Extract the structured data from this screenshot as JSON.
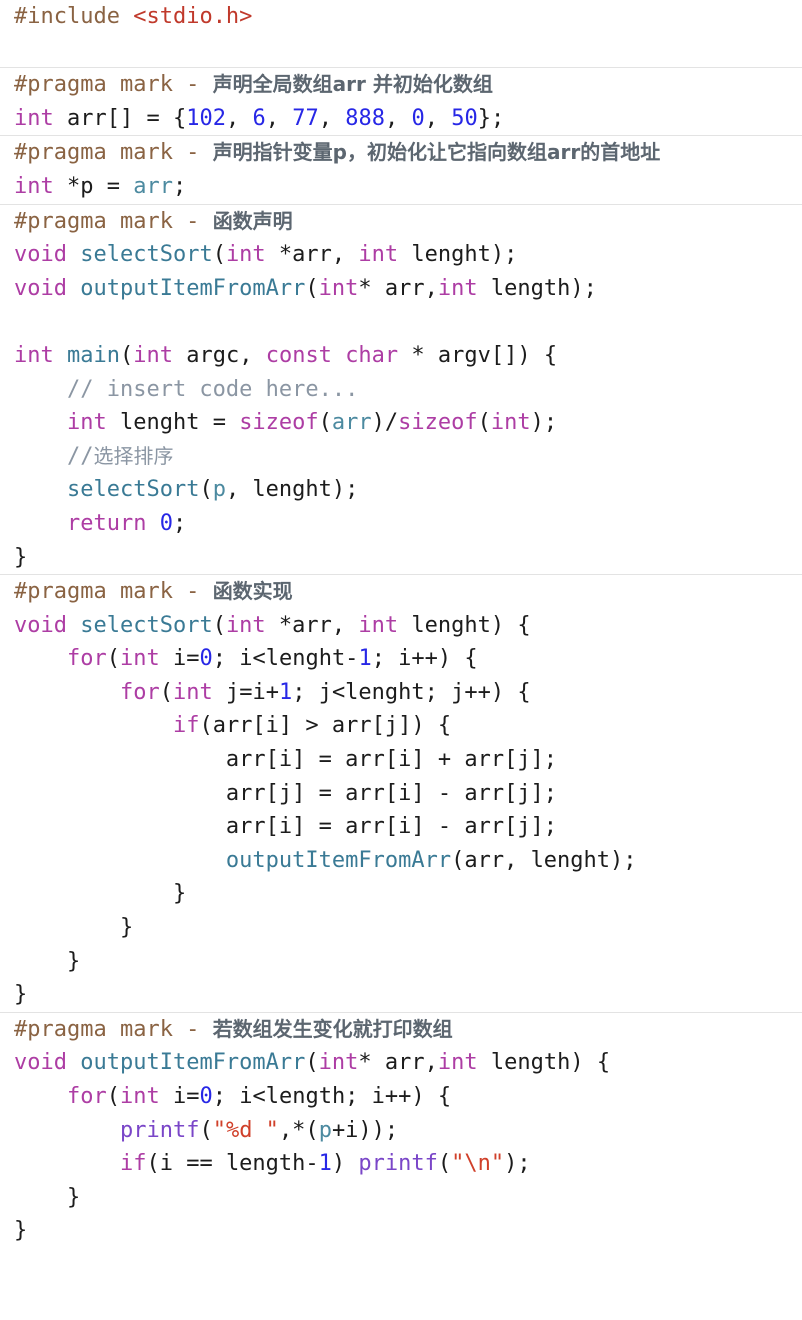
{
  "document": {
    "title": "C source code — selection sort with pointers",
    "language": "c",
    "background": "#ffffff",
    "separator_color": "#e3e3e3"
  },
  "theme": {
    "preprocessor": "#8a6343",
    "header_path": "#c0392b",
    "pragma_text": "#5c6670",
    "keyword": "#ad3da4",
    "number": "#2727e6",
    "function": "#3a7a95",
    "variable": "#4c8aa0",
    "comment": "#8b96a3",
    "builtin": "#7a46c8",
    "string": "#d0402a",
    "plain": "#1c1c1c"
  },
  "sections": [
    {
      "name": "include-section",
      "lines": [
        {
          "id": "l1",
          "text": "#include <stdio.h>",
          "tokens": [
            {
              "t": "#include ",
              "c": "tok-pre"
            },
            {
              "t": "<stdio.h>",
              "c": "tok-header"
            }
          ]
        },
        {
          "id": "l2",
          "text": "",
          "tokens": []
        }
      ]
    },
    {
      "name": "global-array-section",
      "lines": [
        {
          "id": "l3",
          "text": "#pragma mark - 声明全局数组arr 并初始化数组",
          "tokens": [
            {
              "t": "#pragma mark - ",
              "c": "tok-pre"
            },
            {
              "t": "声明全局数组arr 并初始化数组",
              "c": "tok-pragma-cn"
            }
          ]
        },
        {
          "id": "l4",
          "text": "int arr[] = {102, 6, 77, 888, 0, 50};",
          "tokens": [
            {
              "t": "int",
              "c": "tok-kw"
            },
            {
              "t": " arr[] = {",
              "c": "tok-plain"
            },
            {
              "t": "102",
              "c": "tok-num"
            },
            {
              "t": ", ",
              "c": "tok-plain"
            },
            {
              "t": "6",
              "c": "tok-num"
            },
            {
              "t": ", ",
              "c": "tok-plain"
            },
            {
              "t": "77",
              "c": "tok-num"
            },
            {
              "t": ", ",
              "c": "tok-plain"
            },
            {
              "t": "888",
              "c": "tok-num"
            },
            {
              "t": ", ",
              "c": "tok-plain"
            },
            {
              "t": "0",
              "c": "tok-num"
            },
            {
              "t": ", ",
              "c": "tok-plain"
            },
            {
              "t": "50",
              "c": "tok-num"
            },
            {
              "t": "};",
              "c": "tok-plain"
            }
          ]
        }
      ]
    },
    {
      "name": "pointer-declaration-section",
      "lines": [
        {
          "id": "l5",
          "text": "#pragma mark - 声明指针变量p, 初始化让它指向数组arr的首地址",
          "tokens": [
            {
              "t": "#pragma mark - ",
              "c": "tok-pre"
            },
            {
              "t": "声明指针变量p，初始化让它指向数组arr的首地址",
              "c": "tok-pragma-cn"
            }
          ]
        },
        {
          "id": "l6",
          "text": "int *p = arr;",
          "tokens": [
            {
              "t": "int",
              "c": "tok-kw"
            },
            {
              "t": " *p = ",
              "c": "tok-plain"
            },
            {
              "t": "arr",
              "c": "tok-var"
            },
            {
              "t": ";",
              "c": "tok-plain"
            }
          ]
        }
      ]
    },
    {
      "name": "function-declaration-section",
      "lines": [
        {
          "id": "l7",
          "text": "#pragma mark - 函数声明",
          "tokens": [
            {
              "t": "#pragma mark - ",
              "c": "tok-pre"
            },
            {
              "t": "函数声明",
              "c": "tok-pragma-cn"
            }
          ]
        },
        {
          "id": "l8",
          "text": "void selectSort(int *arr, int lenght);",
          "tokens": [
            {
              "t": "void",
              "c": "tok-kw"
            },
            {
              "t": " ",
              "c": "tok-plain"
            },
            {
              "t": "selectSort",
              "c": "tok-fn"
            },
            {
              "t": "(",
              "c": "tok-plain"
            },
            {
              "t": "int",
              "c": "tok-kw"
            },
            {
              "t": " *arr, ",
              "c": "tok-plain"
            },
            {
              "t": "int",
              "c": "tok-kw"
            },
            {
              "t": " lenght);",
              "c": "tok-plain"
            }
          ]
        },
        {
          "id": "l9",
          "text": "void outputItemFromArr(int* arr,int length);",
          "tokens": [
            {
              "t": "void",
              "c": "tok-kw"
            },
            {
              "t": " ",
              "c": "tok-plain"
            },
            {
              "t": "outputItemFromArr",
              "c": "tok-fn"
            },
            {
              "t": "(",
              "c": "tok-plain"
            },
            {
              "t": "int",
              "c": "tok-kw"
            },
            {
              "t": "* arr,",
              "c": "tok-plain"
            },
            {
              "t": "int",
              "c": "tok-kw"
            },
            {
              "t": " length);",
              "c": "tok-plain"
            }
          ]
        },
        {
          "id": "l10",
          "text": "",
          "tokens": []
        },
        {
          "id": "l11",
          "text": "int main(int argc, const char * argv[]) {",
          "tokens": [
            {
              "t": "int",
              "c": "tok-kw"
            },
            {
              "t": " ",
              "c": "tok-plain"
            },
            {
              "t": "main",
              "c": "tok-fn"
            },
            {
              "t": "(",
              "c": "tok-plain"
            },
            {
              "t": "int",
              "c": "tok-kw"
            },
            {
              "t": " argc, ",
              "c": "tok-plain"
            },
            {
              "t": "const",
              "c": "tok-kw"
            },
            {
              "t": " ",
              "c": "tok-plain"
            },
            {
              "t": "char",
              "c": "tok-kw"
            },
            {
              "t": " * argv[]) {",
              "c": "tok-plain"
            }
          ]
        },
        {
          "id": "l12",
          "text": "    // insert code here...",
          "tokens": [
            {
              "t": "    ",
              "c": "tok-plain"
            },
            {
              "t": "// insert code here...",
              "c": "tok-comment"
            }
          ]
        },
        {
          "id": "l13",
          "text": "    int lenght = sizeof(arr)/sizeof(int);",
          "tokens": [
            {
              "t": "    ",
              "c": "tok-plain"
            },
            {
              "t": "int",
              "c": "tok-kw"
            },
            {
              "t": " lenght = ",
              "c": "tok-plain"
            },
            {
              "t": "sizeof",
              "c": "tok-kw"
            },
            {
              "t": "(",
              "c": "tok-plain"
            },
            {
              "t": "arr",
              "c": "tok-var"
            },
            {
              "t": ")/",
              "c": "tok-plain"
            },
            {
              "t": "sizeof",
              "c": "tok-kw"
            },
            {
              "t": "(",
              "c": "tok-plain"
            },
            {
              "t": "int",
              "c": "tok-kw"
            },
            {
              "t": ");",
              "c": "tok-plain"
            }
          ]
        },
        {
          "id": "l14",
          "text": "    //选择排序",
          "tokens": [
            {
              "t": "    ",
              "c": "tok-plain"
            },
            {
              "t": "//",
              "c": "tok-comment"
            },
            {
              "t": "选择排序",
              "c": "tok-comment-cn"
            }
          ]
        },
        {
          "id": "l15",
          "text": "    selectSort(p, lenght);",
          "tokens": [
            {
              "t": "    ",
              "c": "tok-plain"
            },
            {
              "t": "selectSort",
              "c": "tok-fn"
            },
            {
              "t": "(",
              "c": "tok-plain"
            },
            {
              "t": "p",
              "c": "tok-var"
            },
            {
              "t": ", lenght);",
              "c": "tok-plain"
            }
          ]
        },
        {
          "id": "l16",
          "text": "    return 0;",
          "tokens": [
            {
              "t": "    ",
              "c": "tok-plain"
            },
            {
              "t": "return",
              "c": "tok-kw"
            },
            {
              "t": " ",
              "c": "tok-plain"
            },
            {
              "t": "0",
              "c": "tok-num"
            },
            {
              "t": ";",
              "c": "tok-plain"
            }
          ]
        },
        {
          "id": "l17",
          "text": "}",
          "tokens": [
            {
              "t": "}",
              "c": "tok-plain"
            }
          ]
        }
      ]
    },
    {
      "name": "function-implementation-section",
      "lines": [
        {
          "id": "l18",
          "text": "#pragma mark - 函数实现",
          "tokens": [
            {
              "t": "#pragma mark - ",
              "c": "tok-pre"
            },
            {
              "t": "函数实现",
              "c": "tok-pragma-cn"
            }
          ]
        },
        {
          "id": "l19",
          "text": "void selectSort(int *arr, int lenght) {",
          "tokens": [
            {
              "t": "void",
              "c": "tok-kw"
            },
            {
              "t": " ",
              "c": "tok-plain"
            },
            {
              "t": "selectSort",
              "c": "tok-fn"
            },
            {
              "t": "(",
              "c": "tok-plain"
            },
            {
              "t": "int",
              "c": "tok-kw"
            },
            {
              "t": " *arr, ",
              "c": "tok-plain"
            },
            {
              "t": "int",
              "c": "tok-kw"
            },
            {
              "t": " lenght) {",
              "c": "tok-plain"
            }
          ]
        },
        {
          "id": "l20",
          "text": "    for(int i=0; i<lenght-1; i++) {",
          "tokens": [
            {
              "t": "    ",
              "c": "tok-plain"
            },
            {
              "t": "for",
              "c": "tok-kw"
            },
            {
              "t": "(",
              "c": "tok-plain"
            },
            {
              "t": "int",
              "c": "tok-kw"
            },
            {
              "t": " i=",
              "c": "tok-plain"
            },
            {
              "t": "0",
              "c": "tok-num"
            },
            {
              "t": "; i<lenght-",
              "c": "tok-plain"
            },
            {
              "t": "1",
              "c": "tok-num"
            },
            {
              "t": "; i++) {",
              "c": "tok-plain"
            }
          ]
        },
        {
          "id": "l21",
          "text": "        for(int j=i+1; j<lenght; j++) {",
          "tokens": [
            {
              "t": "        ",
              "c": "tok-plain"
            },
            {
              "t": "for",
              "c": "tok-kw"
            },
            {
              "t": "(",
              "c": "tok-plain"
            },
            {
              "t": "int",
              "c": "tok-kw"
            },
            {
              "t": " j=i+",
              "c": "tok-plain"
            },
            {
              "t": "1",
              "c": "tok-num"
            },
            {
              "t": "; j<lenght; j++) {",
              "c": "tok-plain"
            }
          ]
        },
        {
          "id": "l22",
          "text": "            if(arr[i] > arr[j]) {",
          "tokens": [
            {
              "t": "            ",
              "c": "tok-plain"
            },
            {
              "t": "if",
              "c": "tok-kw"
            },
            {
              "t": "(arr[i] > arr[j]) {",
              "c": "tok-plain"
            }
          ]
        },
        {
          "id": "l23",
          "text": "                arr[i] = arr[i] + arr[j];",
          "tokens": [
            {
              "t": "                arr[i] = arr[i] + arr[j];",
              "c": "tok-plain"
            }
          ]
        },
        {
          "id": "l24",
          "text": "                arr[j] = arr[i] - arr[j];",
          "tokens": [
            {
              "t": "                arr[j] = arr[i] - arr[j];",
              "c": "tok-plain"
            }
          ]
        },
        {
          "id": "l25",
          "text": "                arr[i] = arr[i] - arr[j];",
          "tokens": [
            {
              "t": "                arr[i] = arr[i] - arr[j];",
              "c": "tok-plain"
            }
          ]
        },
        {
          "id": "l26",
          "text": "                outputItemFromArr(arr, lenght);",
          "tokens": [
            {
              "t": "                ",
              "c": "tok-plain"
            },
            {
              "t": "outputItemFromArr",
              "c": "tok-fn"
            },
            {
              "t": "(arr, lenght);",
              "c": "tok-plain"
            }
          ]
        },
        {
          "id": "l27",
          "text": "            }",
          "tokens": [
            {
              "t": "            }",
              "c": "tok-plain"
            }
          ]
        },
        {
          "id": "l28",
          "text": "        }",
          "tokens": [
            {
              "t": "        }",
              "c": "tok-plain"
            }
          ]
        },
        {
          "id": "l29",
          "text": "    }",
          "tokens": [
            {
              "t": "    }",
              "c": "tok-plain"
            }
          ]
        },
        {
          "id": "l30",
          "text": "}",
          "tokens": [
            {
              "t": "}",
              "c": "tok-plain"
            }
          ]
        }
      ]
    },
    {
      "name": "print-array-section",
      "lines": [
        {
          "id": "l31",
          "text": "#pragma mark - 若数组发生变化就打印数组",
          "tokens": [
            {
              "t": "#pragma mark - ",
              "c": "tok-pre"
            },
            {
              "t": "若数组发生变化就打印数组",
              "c": "tok-pragma-cn"
            }
          ]
        },
        {
          "id": "l32",
          "text": "void outputItemFromArr(int* arr,int length) {",
          "tokens": [
            {
              "t": "void",
              "c": "tok-kw"
            },
            {
              "t": " ",
              "c": "tok-plain"
            },
            {
              "t": "outputItemFromArr",
              "c": "tok-fn"
            },
            {
              "t": "(",
              "c": "tok-plain"
            },
            {
              "t": "int",
              "c": "tok-kw"
            },
            {
              "t": "* arr,",
              "c": "tok-plain"
            },
            {
              "t": "int",
              "c": "tok-kw"
            },
            {
              "t": " length) {",
              "c": "tok-plain"
            }
          ]
        },
        {
          "id": "l33",
          "text": "    for(int i=0; i<length; i++) {",
          "tokens": [
            {
              "t": "    ",
              "c": "tok-plain"
            },
            {
              "t": "for",
              "c": "tok-kw"
            },
            {
              "t": "(",
              "c": "tok-plain"
            },
            {
              "t": "int",
              "c": "tok-kw"
            },
            {
              "t": " i=",
              "c": "tok-plain"
            },
            {
              "t": "0",
              "c": "tok-num"
            },
            {
              "t": "; i<length; i++) {",
              "c": "tok-plain"
            }
          ]
        },
        {
          "id": "l34",
          "text": "        printf(\"%d \",*(p+i));",
          "tokens": [
            {
              "t": "        ",
              "c": "tok-plain"
            },
            {
              "t": "printf",
              "c": "tok-builtin"
            },
            {
              "t": "(",
              "c": "tok-plain"
            },
            {
              "t": "\"%d \"",
              "c": "tok-str"
            },
            {
              "t": ",*(",
              "c": "tok-plain"
            },
            {
              "t": "p",
              "c": "tok-var"
            },
            {
              "t": "+i));",
              "c": "tok-plain"
            }
          ]
        },
        {
          "id": "l35",
          "text": "        if(i == length-1) printf(\"\\n\");",
          "tokens": [
            {
              "t": "        ",
              "c": "tok-plain"
            },
            {
              "t": "if",
              "c": "tok-kw"
            },
            {
              "t": "(i == length-",
              "c": "tok-plain"
            },
            {
              "t": "1",
              "c": "tok-num"
            },
            {
              "t": ") ",
              "c": "tok-plain"
            },
            {
              "t": "printf",
              "c": "tok-builtin"
            },
            {
              "t": "(",
              "c": "tok-plain"
            },
            {
              "t": "\"\\n\"",
              "c": "tok-str"
            },
            {
              "t": ");",
              "c": "tok-plain"
            }
          ]
        },
        {
          "id": "l36",
          "text": "    }",
          "tokens": [
            {
              "t": "    }",
              "c": "tok-plain"
            }
          ]
        },
        {
          "id": "l37",
          "text": "}",
          "tokens": [
            {
              "t": "}",
              "c": "tok-plain"
            }
          ]
        }
      ]
    }
  ]
}
